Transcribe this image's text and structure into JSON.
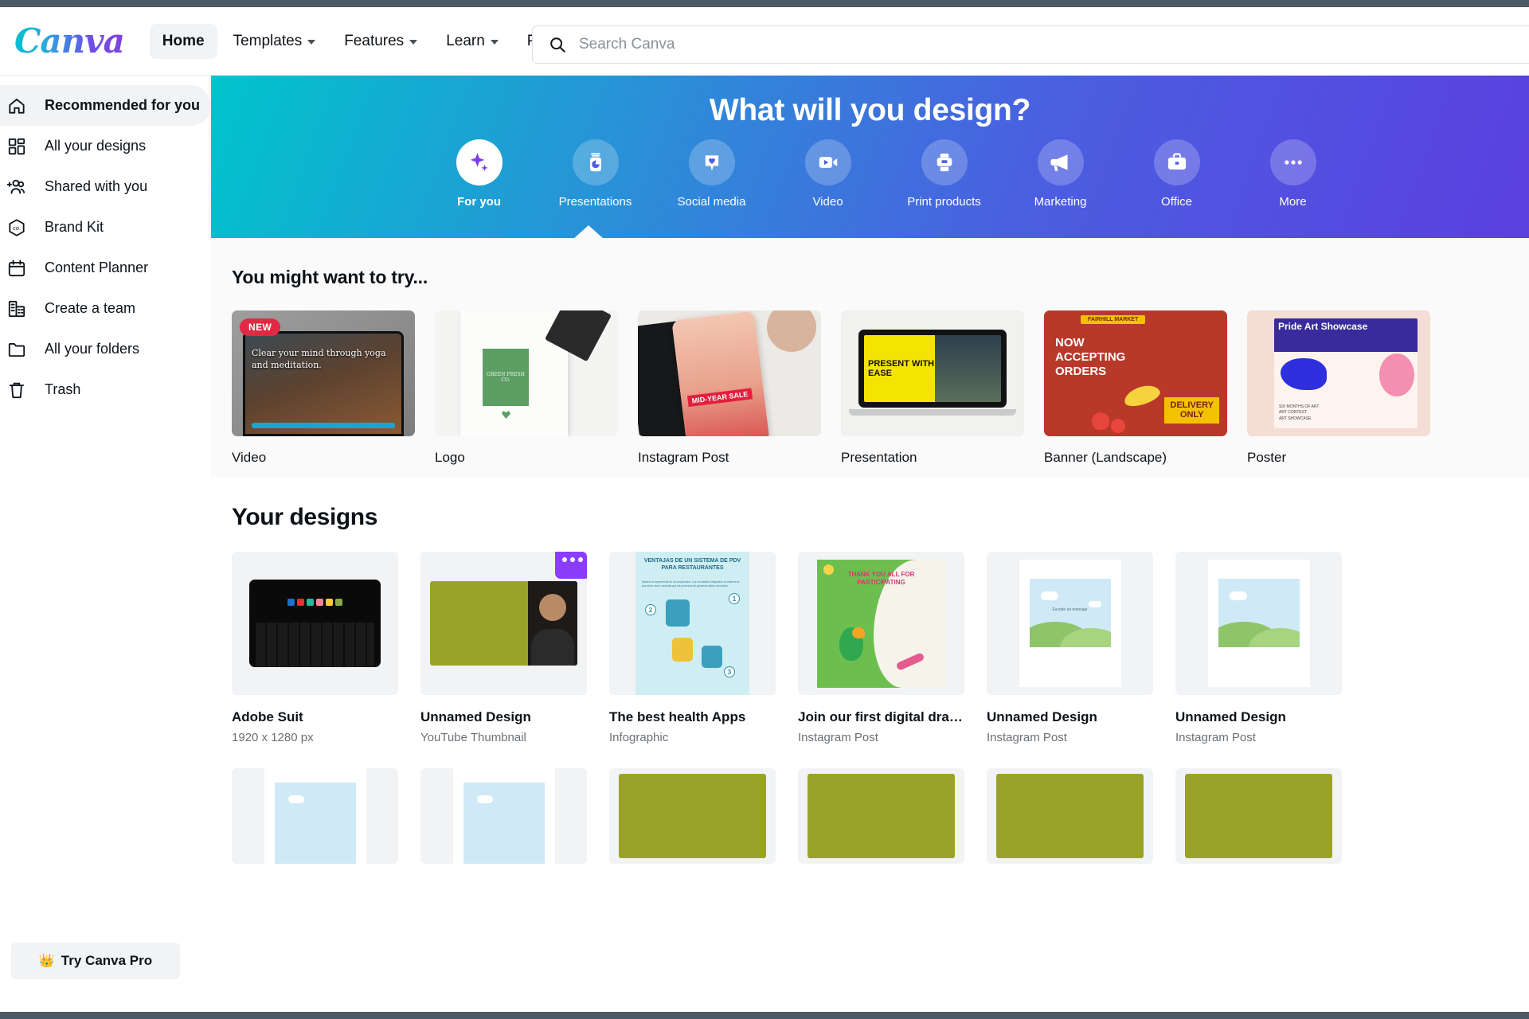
{
  "header": {
    "logo_text": "Canva",
    "nav": [
      {
        "label": "Home",
        "has_caret": false,
        "active": true
      },
      {
        "label": "Templates",
        "has_caret": true,
        "active": false
      },
      {
        "label": "Features",
        "has_caret": true,
        "active": false
      },
      {
        "label": "Learn",
        "has_caret": true,
        "active": false
      },
      {
        "label": "Pricing",
        "has_caret": true,
        "active": false
      }
    ],
    "search": {
      "placeholder": "Search Canva",
      "value": "",
      "icon": "search-icon"
    }
  },
  "sidebar": {
    "items": [
      {
        "label": "Recommended for you",
        "icon": "home-icon",
        "active": true
      },
      {
        "label": "All your designs",
        "icon": "grid-icon",
        "active": false
      },
      {
        "label": "Shared with you",
        "icon": "add-people-icon",
        "active": false
      },
      {
        "label": "Brand Kit",
        "icon": "brand-hexagon-icon",
        "active": false
      },
      {
        "label": "Content Planner",
        "icon": "calendar-icon",
        "active": false
      },
      {
        "label": "Create a team",
        "icon": "building-icon",
        "active": false
      },
      {
        "label": "All your folders",
        "icon": "folder-icon",
        "active": false
      },
      {
        "label": "Trash",
        "icon": "trash-icon",
        "active": false
      }
    ],
    "pro_button": {
      "label": "Try Canva Pro",
      "icon": "crown-icon",
      "crown": "👑"
    }
  },
  "banner": {
    "title": "What will you design?",
    "categories": [
      {
        "label": "For you",
        "icon": "sparkle-icon",
        "selected": true
      },
      {
        "label": "Presentations",
        "icon": "presentation-chart-icon",
        "selected": false
      },
      {
        "label": "Social media",
        "icon": "heart-pin-icon",
        "selected": false
      },
      {
        "label": "Video",
        "icon": "video-camera-icon",
        "selected": false
      },
      {
        "label": "Print products",
        "icon": "printer-icon",
        "selected": false
      },
      {
        "label": "Marketing",
        "icon": "megaphone-icon",
        "selected": false
      },
      {
        "label": "Office",
        "icon": "briefcase-icon",
        "selected": false
      },
      {
        "label": "More",
        "icon": "ellipsis-icon",
        "selected": false
      }
    ],
    "colors": {
      "start": "#00c4cc",
      "mid": "#2b8fd8",
      "end": "#5b3fe0"
    }
  },
  "try_section": {
    "title": "You might want to try...",
    "cards": [
      {
        "label": "Video",
        "badge": "NEW",
        "art": "tablet-yoga",
        "art_text": "Clear your mind through yoga and meditation."
      },
      {
        "label": "Logo",
        "badge": "",
        "art": "green-logo-card",
        "art_text": "GREEN FRESH CO."
      },
      {
        "label": "Instagram Post",
        "badge": "",
        "art": "phone-midyear-sale",
        "art_text": "MID-YEAR SALE"
      },
      {
        "label": "Presentation",
        "badge": "",
        "art": "laptop-present",
        "art_text": "PRESENT WITH EASE"
      },
      {
        "label": "Banner (Landscape)",
        "badge": "",
        "art": "banner-orders",
        "art_text": "NOW ACCEPTING ORDERS  DELIVERY ONLY  FAIRHILL MARKET"
      },
      {
        "label": "Poster",
        "badge": "",
        "art": "pride-art-poster",
        "art_text": "Pride Art Showcase"
      }
    ]
  },
  "designs_section": {
    "title": "Your designs",
    "cards": [
      {
        "title": "Adobe Suit",
        "subtitle": "1920 x 1280 px",
        "art": "dark-laptop",
        "menu": false
      },
      {
        "title": "Unnamed Design",
        "subtitle": "YouTube Thumbnail",
        "art": "olive-person",
        "menu": true
      },
      {
        "title": "The best health Apps",
        "subtitle": "Infographic",
        "art": "infographic-pdv",
        "art_text": "VENTAJAS DE UN SISTEMA DE PDV PARA RESTAURANTES",
        "menu": false
      },
      {
        "title": "Join our first digital drawing ...",
        "subtitle": "Instagram Post",
        "art": "parrot-thanks",
        "art_text": "THANK YOU ALL FOR PARTICIPATING",
        "menu": false
      },
      {
        "title": "Unnamed Design",
        "subtitle": "Instagram Post",
        "art": "cloud-hill",
        "art_text": "Escribe un mensaje",
        "menu": false
      },
      {
        "title": "Unnamed Design",
        "subtitle": "Instagram Post",
        "art": "cloud-hill",
        "art_text": "",
        "menu": false
      }
    ],
    "second_row": [
      {
        "art": "cloud-hill"
      },
      {
        "art": "cloud-hill"
      },
      {
        "art": "olive-plain"
      },
      {
        "art": "olive-plain"
      },
      {
        "art": "olive-plain"
      },
      {
        "art": "olive-plain"
      }
    ]
  }
}
